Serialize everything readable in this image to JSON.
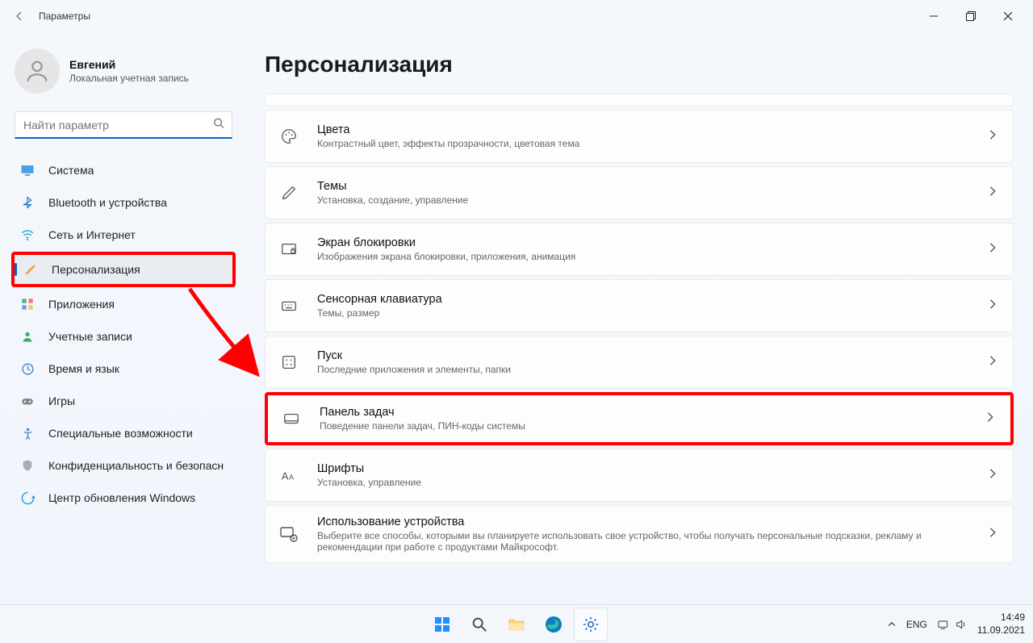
{
  "titlebar": {
    "title": "Параметры"
  },
  "account": {
    "name": "Евгений",
    "sub": "Локальная учетная запись"
  },
  "search": {
    "placeholder": "Найти параметр"
  },
  "nav": {
    "system": "Система",
    "bluetooth": "Bluetooth и устройства",
    "network": "Сеть и Интернет",
    "personalization": "Персонализация",
    "apps": "Приложения",
    "accounts": "Учетные записи",
    "time": "Время и язык",
    "gaming": "Игры",
    "accessibility": "Специальные возможности",
    "privacy": "Конфиденциальность и безопасн",
    "update": "Центр обновления Windows"
  },
  "main": {
    "heading": "Персонализация",
    "colors": {
      "t": "Цвета",
      "s": "Контрастный цвет, эффекты прозрачности, цветовая тема"
    },
    "themes": {
      "t": "Темы",
      "s": "Установка, создание, управление"
    },
    "lockscreen": {
      "t": "Экран блокировки",
      "s": "Изображения экрана блокировки, приложения, анимация"
    },
    "touchkeyboard": {
      "t": "Сенсорная клавиатура",
      "s": "Темы, размер"
    },
    "start": {
      "t": "Пуск",
      "s": "Последние приложения и элементы, папки"
    },
    "taskbar": {
      "t": "Панель задач",
      "s": "Поведение панели задач, ПИН-коды системы"
    },
    "fonts": {
      "t": "Шрифты",
      "s": "Установка, управление"
    },
    "deviceusage": {
      "t": "Использование устройства",
      "s": "Выберите все способы, которыми вы планируете использовать свое устройство, чтобы получать персональные подсказки, рекламу и рекомендации при работе с продуктами Майкрософт."
    }
  },
  "taskbarsys": {
    "lang": "ENG",
    "time": "14:49",
    "date": "11.09.2021"
  }
}
